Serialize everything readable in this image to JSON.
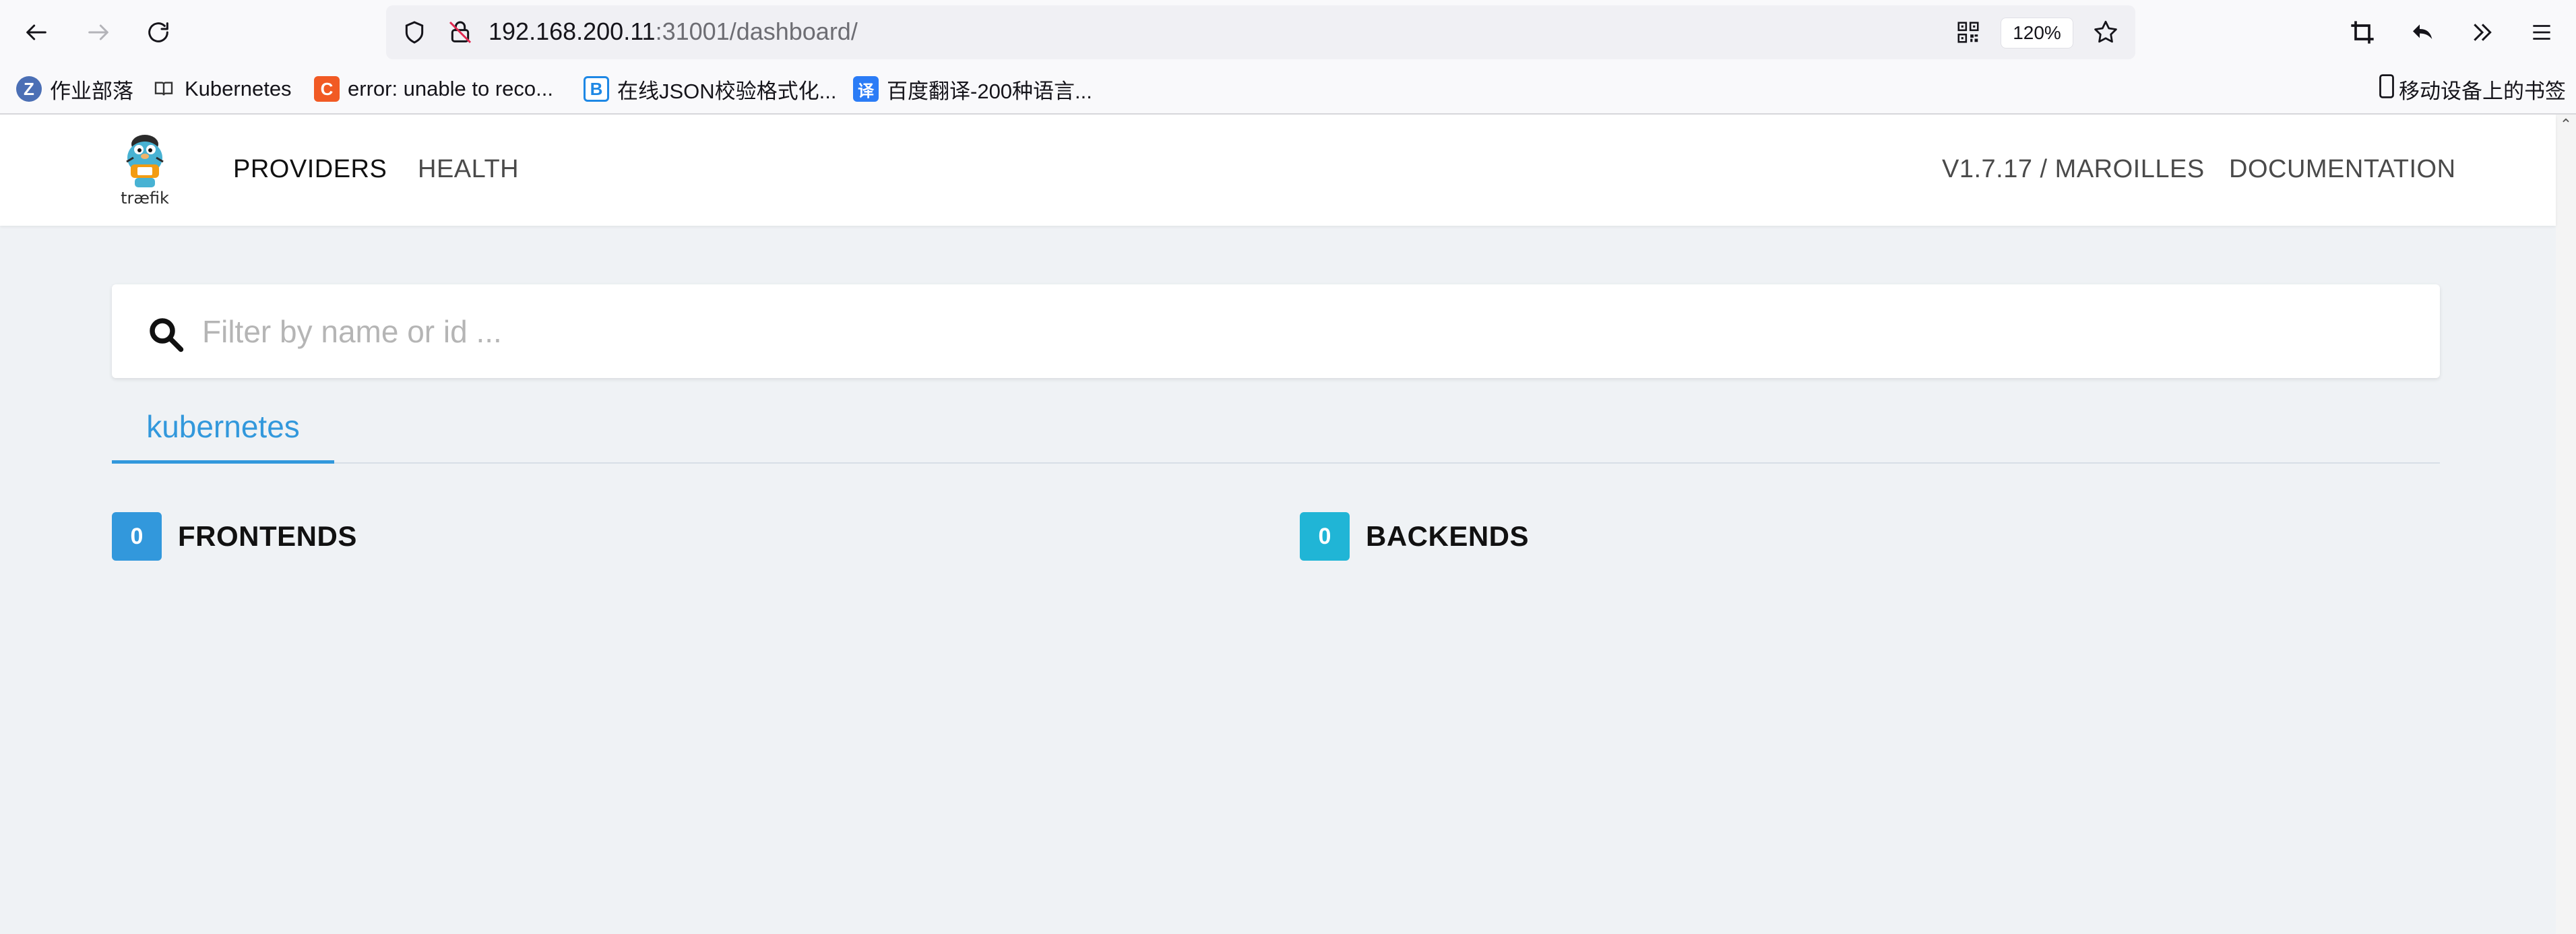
{
  "browser": {
    "back_icon": "arrow-left-icon",
    "forward_icon": "arrow-right-icon",
    "reload_icon": "reload-icon",
    "url_host": "192.168.200.11",
    "url_rest": ":31001/dashboard/",
    "zoom": "120%",
    "bookmarks": [
      {
        "label": "作业部落",
        "icon_color": "#4b6fb5",
        "glyph": "Z"
      },
      {
        "label": "Kubernetes",
        "icon_color": "#555555",
        "glyph": "📖"
      },
      {
        "label": "error: unable to reco...",
        "icon_color": "#f15a24",
        "glyph": "C"
      },
      {
        "label": "在线JSON校验格式化...",
        "icon_color": "#1e88e5",
        "glyph": "B"
      },
      {
        "label": "百度翻译-200种语言...",
        "icon_color": "#2b7cf6",
        "glyph": "译"
      }
    ],
    "mobile_bookmarks": "移动设备上的书签"
  },
  "app": {
    "logo_text": "træfik",
    "nav": {
      "providers": "PROVIDERS",
      "health": "HEALTH",
      "version": "V1.7.17 / MAROILLES",
      "documentation": "DOCUMENTATION"
    },
    "search": {
      "placeholder": "Filter by name or id ..."
    },
    "tabs": [
      {
        "label": "kubernetes",
        "active": true
      }
    ],
    "frontends": {
      "count": "0",
      "title": "FRONTENDS",
      "color": "#3298dc"
    },
    "backends": {
      "count": "0",
      "title": "BACKENDS",
      "color": "#20b5d6"
    }
  }
}
